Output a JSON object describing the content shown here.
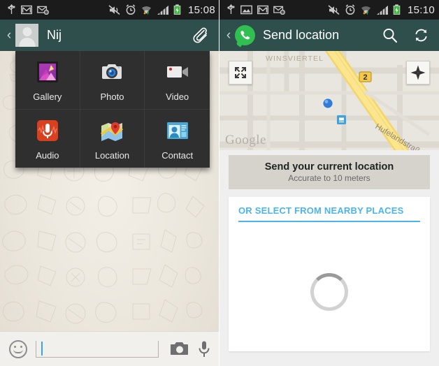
{
  "left": {
    "status_bar": {
      "icons": [
        "usb-icon",
        "gmail-icon",
        "email-icon",
        "sound-muted-icon",
        "alarm-clock-icon",
        "wifi-icon",
        "signal-bars-icon",
        "battery-charging-icon"
      ],
      "time": "15:08"
    },
    "app_bar": {
      "back_label": "‹",
      "contact_name": "Nij",
      "attach_icon": "paperclip-icon"
    },
    "attach_menu": {
      "items": [
        {
          "label": "Gallery",
          "icon": "gallery-icon"
        },
        {
          "label": "Photo",
          "icon": "camera-icon"
        },
        {
          "label": "Video",
          "icon": "video-camera-icon"
        },
        {
          "label": "Audio",
          "icon": "microphone-icon"
        },
        {
          "label": "Location",
          "icon": "map-pin-icon"
        },
        {
          "label": "Contact",
          "icon": "contact-card-icon"
        }
      ]
    },
    "input_bar": {
      "emoji_icon": "smiley-icon",
      "message_value": "",
      "message_placeholder": "",
      "camera_icon": "camera-icon",
      "mic_icon": "microphone-icon"
    }
  },
  "right": {
    "status_bar": {
      "icons": [
        "usb-icon",
        "screenshot-icon",
        "gmail-icon",
        "email-icon",
        "sound-muted-icon",
        "alarm-clock-icon",
        "wifi-icon",
        "signal-bars-icon",
        "battery-charging-icon"
      ],
      "time": "15:10"
    },
    "app_bar": {
      "back_label": "‹",
      "logo_icon": "whatsapp-logo-icon",
      "title": "Send location",
      "search_icon": "search-icon",
      "refresh_icon": "refresh-icon"
    },
    "map": {
      "expand_icon": "expand-arrows-icon",
      "compass_icon": "compass-icon",
      "watermark": "Google",
      "labels": [
        "WINSVIERTEL",
        "Hufelandstraße"
      ],
      "road_shield": "2",
      "current_position_marker": "blue-dot-marker",
      "transit_marker": "train-station-icon"
    },
    "send_current": {
      "title": "Send your current location",
      "subtitle": "Accurate to 10 meters"
    },
    "nearby": {
      "header": "OR SELECT FROM NEARBY PLACES",
      "loading": true,
      "spinner_icon": "loading-spinner-icon"
    }
  },
  "colors": {
    "appbar": "#2e4f4b",
    "statusbar": "#1b1b1b",
    "accent_blue": "#4ab4ec",
    "whatsapp_green": "#30bf50",
    "panel_dark": "#2f2f2f"
  }
}
